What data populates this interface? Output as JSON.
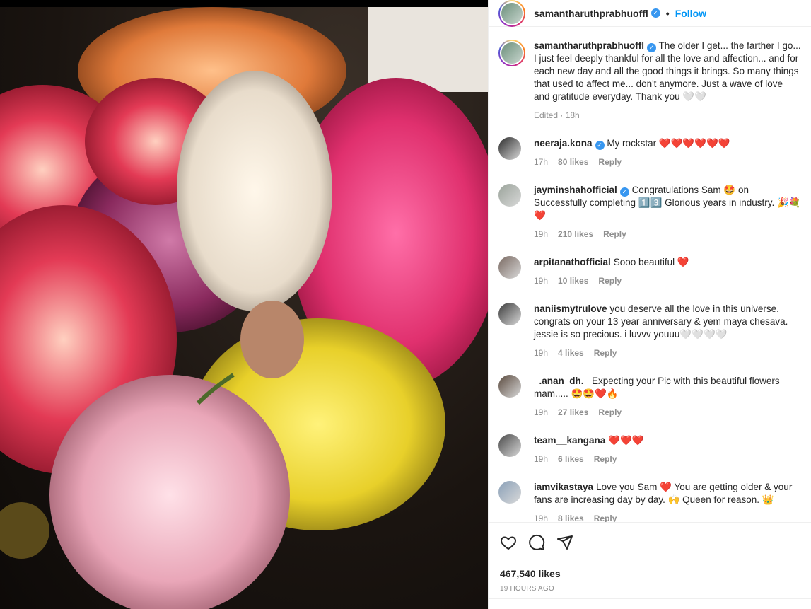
{
  "post": {
    "username": "samantharuthprabhuoffl",
    "separator": "•",
    "follow_label": "Follow",
    "caption": "The older I get... the farther I go... I just feel deeply thankful for all the love and affection... and for each new day and all the good things it brings. So many things that used to affect me... don't anymore. Just a wave of love and gratitude everyday. Thank you 🤍🤍",
    "caption_meta": "Edited · 18h",
    "photo_description_icon": "dahlia-bouquet",
    "likes": "467,540 likes",
    "time_ago": "19 HOURS AGO"
  },
  "comments": [
    {
      "username": "neeraja.kona",
      "verified": true,
      "text": "My rockstar ❤️❤️❤️❤️❤️❤️",
      "time": "17h",
      "likes": "80 likes",
      "reply": "Reply",
      "avatar_color": "#2b2b2b"
    },
    {
      "username": "jayminshahofficial",
      "verified": true,
      "text": "Congratulations Sam 🤩 on Successfully completing 1️⃣3️⃣ Glorious years in industry. 🎉💐❤️",
      "time": "19h",
      "likes": "210 likes",
      "reply": "Reply",
      "avatar_color": "#9aa39a"
    },
    {
      "username": "arpitanathofficial",
      "verified": false,
      "text": "Sooo beautiful ❤️",
      "time": "19h",
      "likes": "10 likes",
      "reply": "Reply",
      "avatar_color": "#7a6a62"
    },
    {
      "username": "naniismytrulove",
      "verified": false,
      "text": "you deserve all the love in this universe. congrats on your 13 year anniversary & yem maya chesava. jessie is so precious. i luvvv youuu🤍🤍🤍🤍",
      "time": "19h",
      "likes": "4 likes",
      "reply": "Reply",
      "avatar_color": "#3c3c3c"
    },
    {
      "username": "_.anan_dh._",
      "verified": false,
      "text": "Expecting your Pic with this beautiful flowers mam..... 🤩🤩❤️🔥",
      "time": "19h",
      "likes": "27 likes",
      "reply": "Reply",
      "avatar_color": "#5a4a3e"
    },
    {
      "username": "team__kangana",
      "verified": false,
      "text": "❤️❤️❤️",
      "time": "19h",
      "likes": "6 likes",
      "reply": "Reply",
      "avatar_color": "#4a4a4a"
    },
    {
      "username": "iamvikastaya",
      "verified": false,
      "text": "Love you Sam ❤️ You are getting older & your fans are increasing day by day. 🙌 Queen for reason. 👑",
      "time": "19h",
      "likes": "8 likes",
      "reply": "Reply",
      "avatar_color": "#8aa0b8"
    }
  ],
  "icons": [
    "heart-icon",
    "comment-icon",
    "share-icon"
  ],
  "colors": {
    "link": "#0095f6",
    "verified": "#3897f0",
    "muted": "#8e8e8e"
  }
}
